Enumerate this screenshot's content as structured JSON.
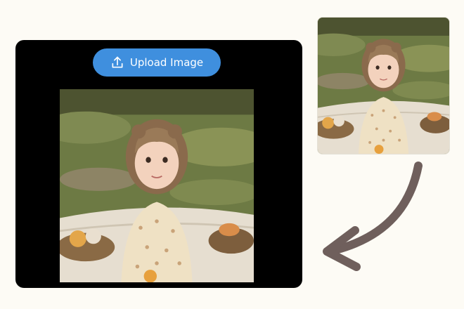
{
  "upload_button": {
    "label": "Upload Image",
    "icon": "upload-icon"
  },
  "preview_image": {
    "description_icon": "photo-girl-easter-picnic"
  },
  "thumbnail_image": {
    "description_icon": "photo-girl-easter-picnic"
  },
  "arrow": {
    "icon": "curved-arrow-left-icon",
    "color": "#6f5f5c"
  },
  "colors": {
    "background": "#fdfbf5",
    "panel": "#000000",
    "button": "#3f8fde"
  }
}
